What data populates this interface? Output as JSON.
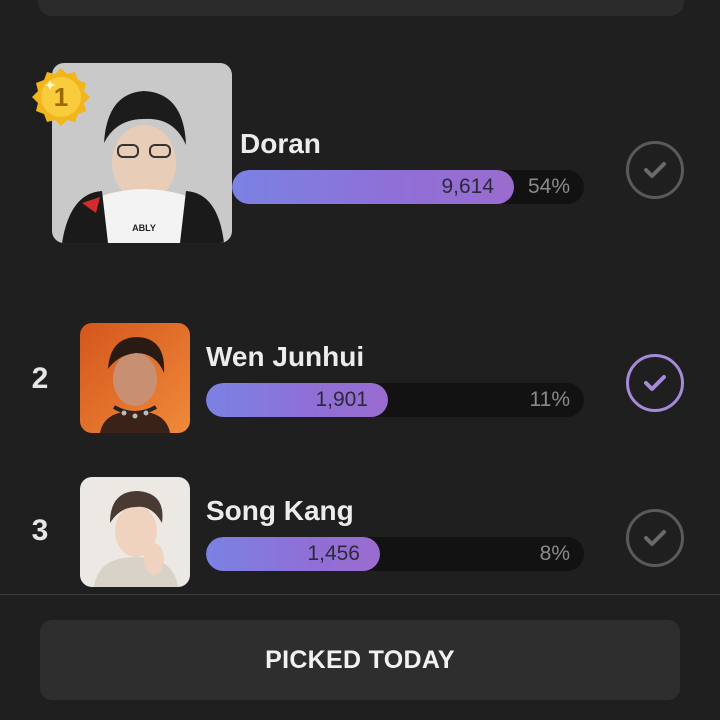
{
  "entries": [
    {
      "rank": "1",
      "name": "Doran",
      "votes": "9,614",
      "percent": "54%",
      "share": 0.54,
      "checked": false
    },
    {
      "rank": "2",
      "name": "Wen Junhui",
      "votes": "1,901",
      "percent": "11%",
      "share": 0.11,
      "checked": true
    },
    {
      "rank": "3",
      "name": "Song Kang",
      "votes": "1,456",
      "percent": "8%",
      "share": 0.08,
      "checked": false
    }
  ],
  "medal": {
    "label": "1",
    "icon": "gold-medal-icon"
  },
  "footer": {
    "button_label": "PICKED TODAY"
  },
  "colors": {
    "background": "#1f1f1f",
    "bar_gradient_start": "#7b82e3",
    "bar_gradient_end": "#9b6ccf",
    "check_active": "#a48ad8",
    "check_inactive": "#5a5a5a"
  }
}
